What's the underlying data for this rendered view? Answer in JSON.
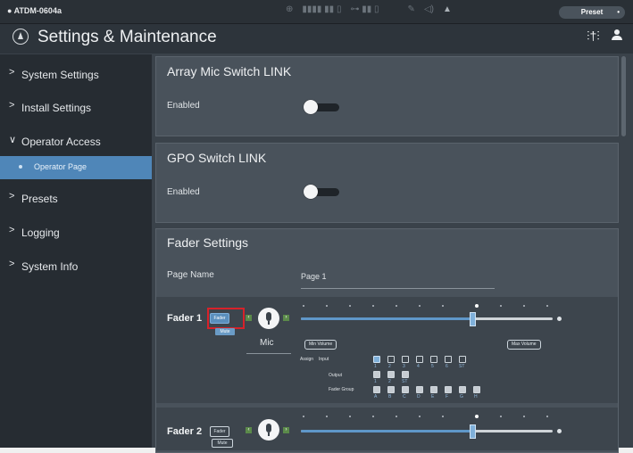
{
  "device": "● ATDM-0604a",
  "status_bar": {
    "preset_label": "Preset",
    "icons": [
      "link-icon",
      "meter-icon",
      "network-icon",
      "usb-icon",
      "edit-icon",
      "speaker-icon",
      "warning-icon"
    ]
  },
  "title": "Settings & Maintenance",
  "sidebar": {
    "items": [
      {
        "label": "System Settings",
        "chevron": ">"
      },
      {
        "label": "Install Settings",
        "chevron": ">"
      },
      {
        "label": "Operator Access",
        "chevron": "∨"
      },
      {
        "label": "Operator Page"
      },
      {
        "label": "Presets",
        "chevron": ">"
      },
      {
        "label": "Logging",
        "chevron": ">"
      },
      {
        "label": "System Info",
        "chevron": ">"
      }
    ]
  },
  "panels": {
    "array_mic": {
      "title": "Array Mic Switch LINK",
      "enabled_label": "Enabled",
      "enabled": false
    },
    "gpo": {
      "title": "GPO Switch LINK",
      "enabled_label": "Enabled",
      "enabled": false
    },
    "fader_settings": {
      "title": "Fader Settings",
      "page_name_label": "Page Name",
      "page_name_value": "Page 1"
    }
  },
  "faders": [
    {
      "name": "Fader 1",
      "fader_btn": "Fader",
      "mute_btn": "Mute",
      "source": "Mic",
      "min_volume": "Min Volume",
      "max_volume": "Max Volume",
      "assign_label": "Assign",
      "input_label": "Input",
      "output_label": "Output",
      "group_label": "Fader Group",
      "inputs": [
        "1",
        "2",
        "3",
        "4",
        "5",
        "6",
        "ST"
      ],
      "outputs": [
        "1",
        "2",
        "ST"
      ],
      "groups": [
        "A",
        "B",
        "C",
        "D",
        "E",
        "F",
        "G",
        "H"
      ],
      "level": 0.68
    },
    {
      "name": "Fader 2",
      "fader_btn": "Fader",
      "mute_btn": "Mute",
      "level": 0.68
    }
  ],
  "colors": {
    "accent": "#4f86b8",
    "highlight": "#d7222a"
  }
}
